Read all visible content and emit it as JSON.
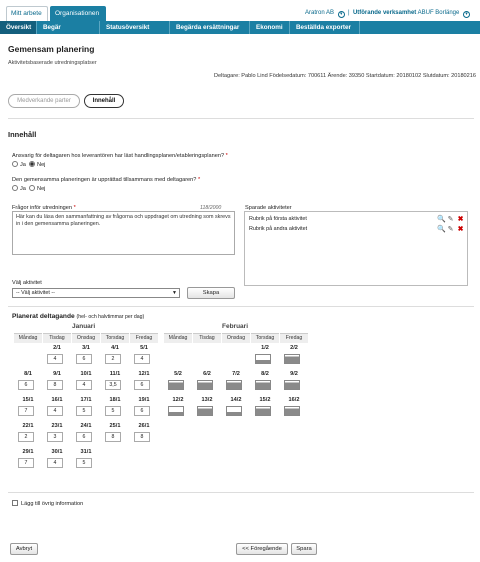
{
  "top": {
    "tab_my_work": "Mitt arbete",
    "tab_org": "Organisationen",
    "org_label": "Aratron AB",
    "unit_label": "Utförande verksamhet",
    "unit_value": "ABUF Borlänge"
  },
  "nav": [
    "Översikt",
    "Begär ersättning",
    "Statusöversikt",
    "Begärda ersättningar",
    "Ekonomi",
    "Beställda exporter"
  ],
  "page": {
    "title": "Gemensam planering",
    "subtitle": "Aktivitetsbaserade utredningsplatser",
    "meta": "Deltagare: Pablo Lind Födelsedatum: 700611 Ärende: 39350 Startdatum: 20180102 Slutdatum: 20180216",
    "seg_partners": "Medverkande parter",
    "seg_content": "Innehåll"
  },
  "content": {
    "heading": "Innehåll",
    "q1": "Ansvarig för deltagaren hos leverantören har läst handlingsplanen/etableringsplanen?",
    "q2": "Den gemensamma planeringen är upprättad tillsammans med deltagaren?",
    "yes": "Ja",
    "no": "Nej",
    "questions_label": "Frågor inför utredningen",
    "char_count": "118/2000",
    "questions_text": "Här kan du läsa den sammanfattning av frågorna och uppdraget om utredning som skrevs in i den gemensamma planeringen.",
    "saved_label": "Sparade aktiviteter",
    "saved": [
      "Rubrik på första aktivitet",
      "Rubrik på andra aktivitet"
    ],
    "select_label": "Välj aktivitet",
    "select_value": "-- Välj aktivitet --",
    "save_btn": "Skapa",
    "plan_title": "Planerat deltagande",
    "plan_hint": "(hel- och halvtimmar per dag)",
    "add_info": "Lägg till övrig information"
  },
  "calendar": {
    "days": [
      "Måndag",
      "Tisdag",
      "Onsdag",
      "Torsdag",
      "Fredag"
    ],
    "january": {
      "name": "Januari",
      "rows": [
        [
          null,
          {
            "d": "2/1",
            "v": "4"
          },
          {
            "d": "3/1",
            "v": "6"
          },
          {
            "d": "4/1",
            "v": "2"
          },
          {
            "d": "5/1",
            "v": "4"
          }
        ],
        [
          {
            "d": "8/1",
            "v": "6"
          },
          {
            "d": "9/1",
            "v": "8"
          },
          {
            "d": "10/1",
            "v": "4"
          },
          {
            "d": "11/1",
            "v": "3,5"
          },
          {
            "d": "12/1",
            "v": "6"
          }
        ],
        [
          {
            "d": "15/1",
            "v": "7"
          },
          {
            "d": "16/1",
            "v": "4"
          },
          {
            "d": "17/1",
            "v": "5"
          },
          {
            "d": "18/1",
            "v": "5"
          },
          {
            "d": "19/1",
            "v": "6"
          }
        ],
        [
          {
            "d": "22/1",
            "v": "2"
          },
          {
            "d": "23/1",
            "v": "3"
          },
          {
            "d": "24/1",
            "v": "6"
          },
          {
            "d": "25/1",
            "v": "8"
          },
          {
            "d": "26/1",
            "v": "8"
          }
        ],
        [
          {
            "d": "29/1",
            "v": "7"
          },
          {
            "d": "30/1",
            "v": "4"
          },
          {
            "d": "31/1",
            "v": "5"
          },
          null,
          null
        ]
      ]
    },
    "february": {
      "name": "Februari",
      "rows": [
        [
          null,
          null,
          null,
          {
            "d": "1/2",
            "k": "half"
          },
          {
            "d": "2/2",
            "k": "full"
          }
        ],
        [
          {
            "d": "5/2",
            "k": "full"
          },
          {
            "d": "6/2",
            "k": "full"
          },
          {
            "d": "7/2",
            "k": "full"
          },
          {
            "d": "8/2",
            "k": "full"
          },
          {
            "d": "9/2",
            "k": "full"
          }
        ],
        [
          {
            "d": "12/2",
            "k": "half"
          },
          {
            "d": "13/2",
            "k": "full"
          },
          {
            "d": "14/2",
            "k": "half"
          },
          {
            "d": "15/2",
            "k": "full"
          },
          {
            "d": "16/2",
            "k": "full"
          }
        ]
      ]
    }
  },
  "footer": {
    "cancel": "Avbryt",
    "prev": "<< Föregående",
    "save": "Spara"
  }
}
